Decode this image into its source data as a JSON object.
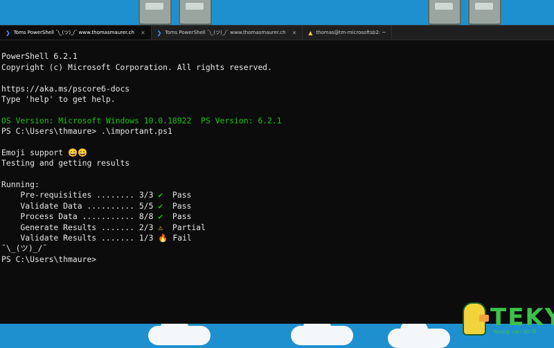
{
  "tabs": [
    {
      "icon": "powershell-icon",
      "label": "Toms PowerShell ¯\\_(ツ)_/¯ www.thomasmaurer.ch",
      "active": true
    },
    {
      "icon": "powershell-icon",
      "label": "Toms PowerShell ¯\\_(ツ)_/¯ www.thomasmaurer.ch",
      "active": false
    },
    {
      "icon": "warning-icon",
      "label": "thomas@tm-microsoftsb2: ~",
      "active": false
    }
  ],
  "console": {
    "l1": "PowerShell 6.2.1",
    "l2": "Copyright (c) Microsoft Corporation. All rights reserved.",
    "l3": "https://aka.ms/pscore6-docs",
    "l4": "Type 'help' to get help.",
    "l5": "OS Version: Microsoft Windows 10.0.18922  PS Version: 6.2.1",
    "l6": "PS C:\\Users\\thmaure> .\\important.ps1",
    "l7": "Emoji support ",
    "l7_emoji": "😀😀",
    "l8": "Testing and getting results",
    "l9": "Running:",
    "rows": [
      {
        "text": "    Pre-requisities ........ 3/3 ",
        "icon": "✔",
        "status": "Pass"
      },
      {
        "text": "    Validate Data .......... 5/5 ",
        "icon": "✔",
        "status": "Pass"
      },
      {
        "text": "    Process Data ........... 8/8 ",
        "icon": "✔",
        "status": "Pass"
      },
      {
        "text": "    Generate Results ....... 2/3 ",
        "icon": "⚠",
        "status": "Partial"
      },
      {
        "text": "    Validate Results ....... 1/3 ",
        "icon": "🔥",
        "status": "Fail"
      }
    ],
    "shrug": "¯\\_(ツ)_/¯",
    "prompt": "PS C:\\Users\\thmaure>"
  },
  "logo": {
    "name": "TEKY",
    "tagline": "Young can do IT"
  },
  "colors": {
    "terminal_bg": "#0c0c0c",
    "green": "#16c60c",
    "wallpaper": "#1e90d0",
    "logo": "#3cc14a"
  }
}
